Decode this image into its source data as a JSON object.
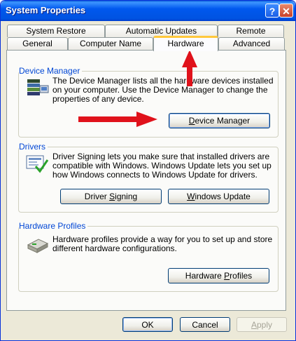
{
  "window": {
    "title": "System Properties"
  },
  "tabs": {
    "row_back": [
      "System Restore",
      "Automatic Updates",
      "Remote"
    ],
    "row_front": [
      "General",
      "Computer Name",
      "Hardware",
      "Advanced"
    ],
    "active": "Hardware"
  },
  "device_manager": {
    "label": "Device Manager",
    "description": [
      "The Device Manager lists all the hardware devices installed",
      "on your computer. Use the Device Manager to change the",
      "properties of any device."
    ],
    "button": {
      "pre": "",
      "acc": "D",
      "post": "evice Manager"
    }
  },
  "drivers": {
    "label": "Drivers",
    "description": [
      "Driver Signing lets you make sure that installed drivers are",
      "compatible with Windows. Windows Update lets you set up",
      "how Windows connects to Windows Update for drivers."
    ],
    "signing_button": {
      "pre": "Driver ",
      "acc": "S",
      "post": "igning"
    },
    "update_button": {
      "pre": "",
      "acc": "W",
      "post": "indows Update"
    }
  },
  "hardware_profiles": {
    "label": "Hardware Profiles",
    "description": [
      "Hardware profiles provide a way for you to set up and store",
      "different hardware configurations."
    ],
    "button": {
      "pre": "Hardware ",
      "acc": "P",
      "post": "rofiles"
    }
  },
  "footer": {
    "ok": "OK",
    "cancel": "Cancel",
    "apply": {
      "pre": "",
      "acc": "A",
      "post": "pply"
    }
  },
  "colors": {
    "annotation_arrow": "#e0121b",
    "group_label": "#0046d5",
    "titlebar": "#0058ee"
  }
}
